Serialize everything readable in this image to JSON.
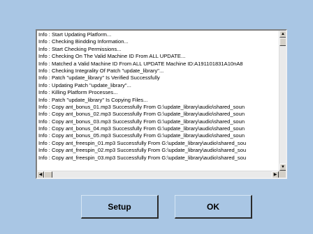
{
  "log": {
    "lines": [
      "Info : Start Updating Platform...",
      "Info : Checking Bindding Information...",
      "Info : Start Checking Permissions...",
      "Info : Checking On The Valid Machine ID From ALL UPDATE...",
      "Info : Matched a Valid Machine ID From ALL UPDATE Machine ID:A191101831A10nA8",
      "Info : Checking Integrality Of Patch \"update_library\"...",
      "Info : Patch \"update_library\" Is Verified Successfully",
      "Info : Updating Patch \"update_library\"...",
      "Info : Killing Platform Processes...",
      "Info : Patch \"update_library\" Is Copying Files...",
      "Info : Copy ant_bonus_01.mp3 Successfully From G:\\update_library\\audio\\shared_soun",
      "Info : Copy ant_bonus_02.mp3 Successfully From G:\\update_library\\audio\\shared_soun",
      "Info : Copy ant_bonus_03.mp3 Successfully From G:\\update_library\\audio\\shared_soun",
      "Info : Copy ant_bonus_04.mp3 Successfully From G:\\update_library\\audio\\shared_soun",
      "Info : Copy ant_bonus_05.mp3 Successfully From G:\\update_library\\audio\\shared_soun",
      "Info : Copy ant_freespin_01.mp3 Successfully From G:\\update_library\\audio\\shared_sou",
      "Info : Copy ant_freespin_02.mp3 Successfully From G:\\update_library\\audio\\shared_sou",
      "Info : Copy ant_freespin_03.mp3 Successfully From G:\\update_library\\audio\\shared_sou"
    ]
  },
  "buttons": {
    "setup_label": "Setup",
    "ok_label": "OK"
  },
  "icons": {
    "scroll_up": "▲",
    "scroll_down": "▼",
    "scroll_left": "◀",
    "scroll_right": "▶"
  },
  "colors": {
    "background": "#a9c6e4",
    "log_background": "#ffffff"
  }
}
